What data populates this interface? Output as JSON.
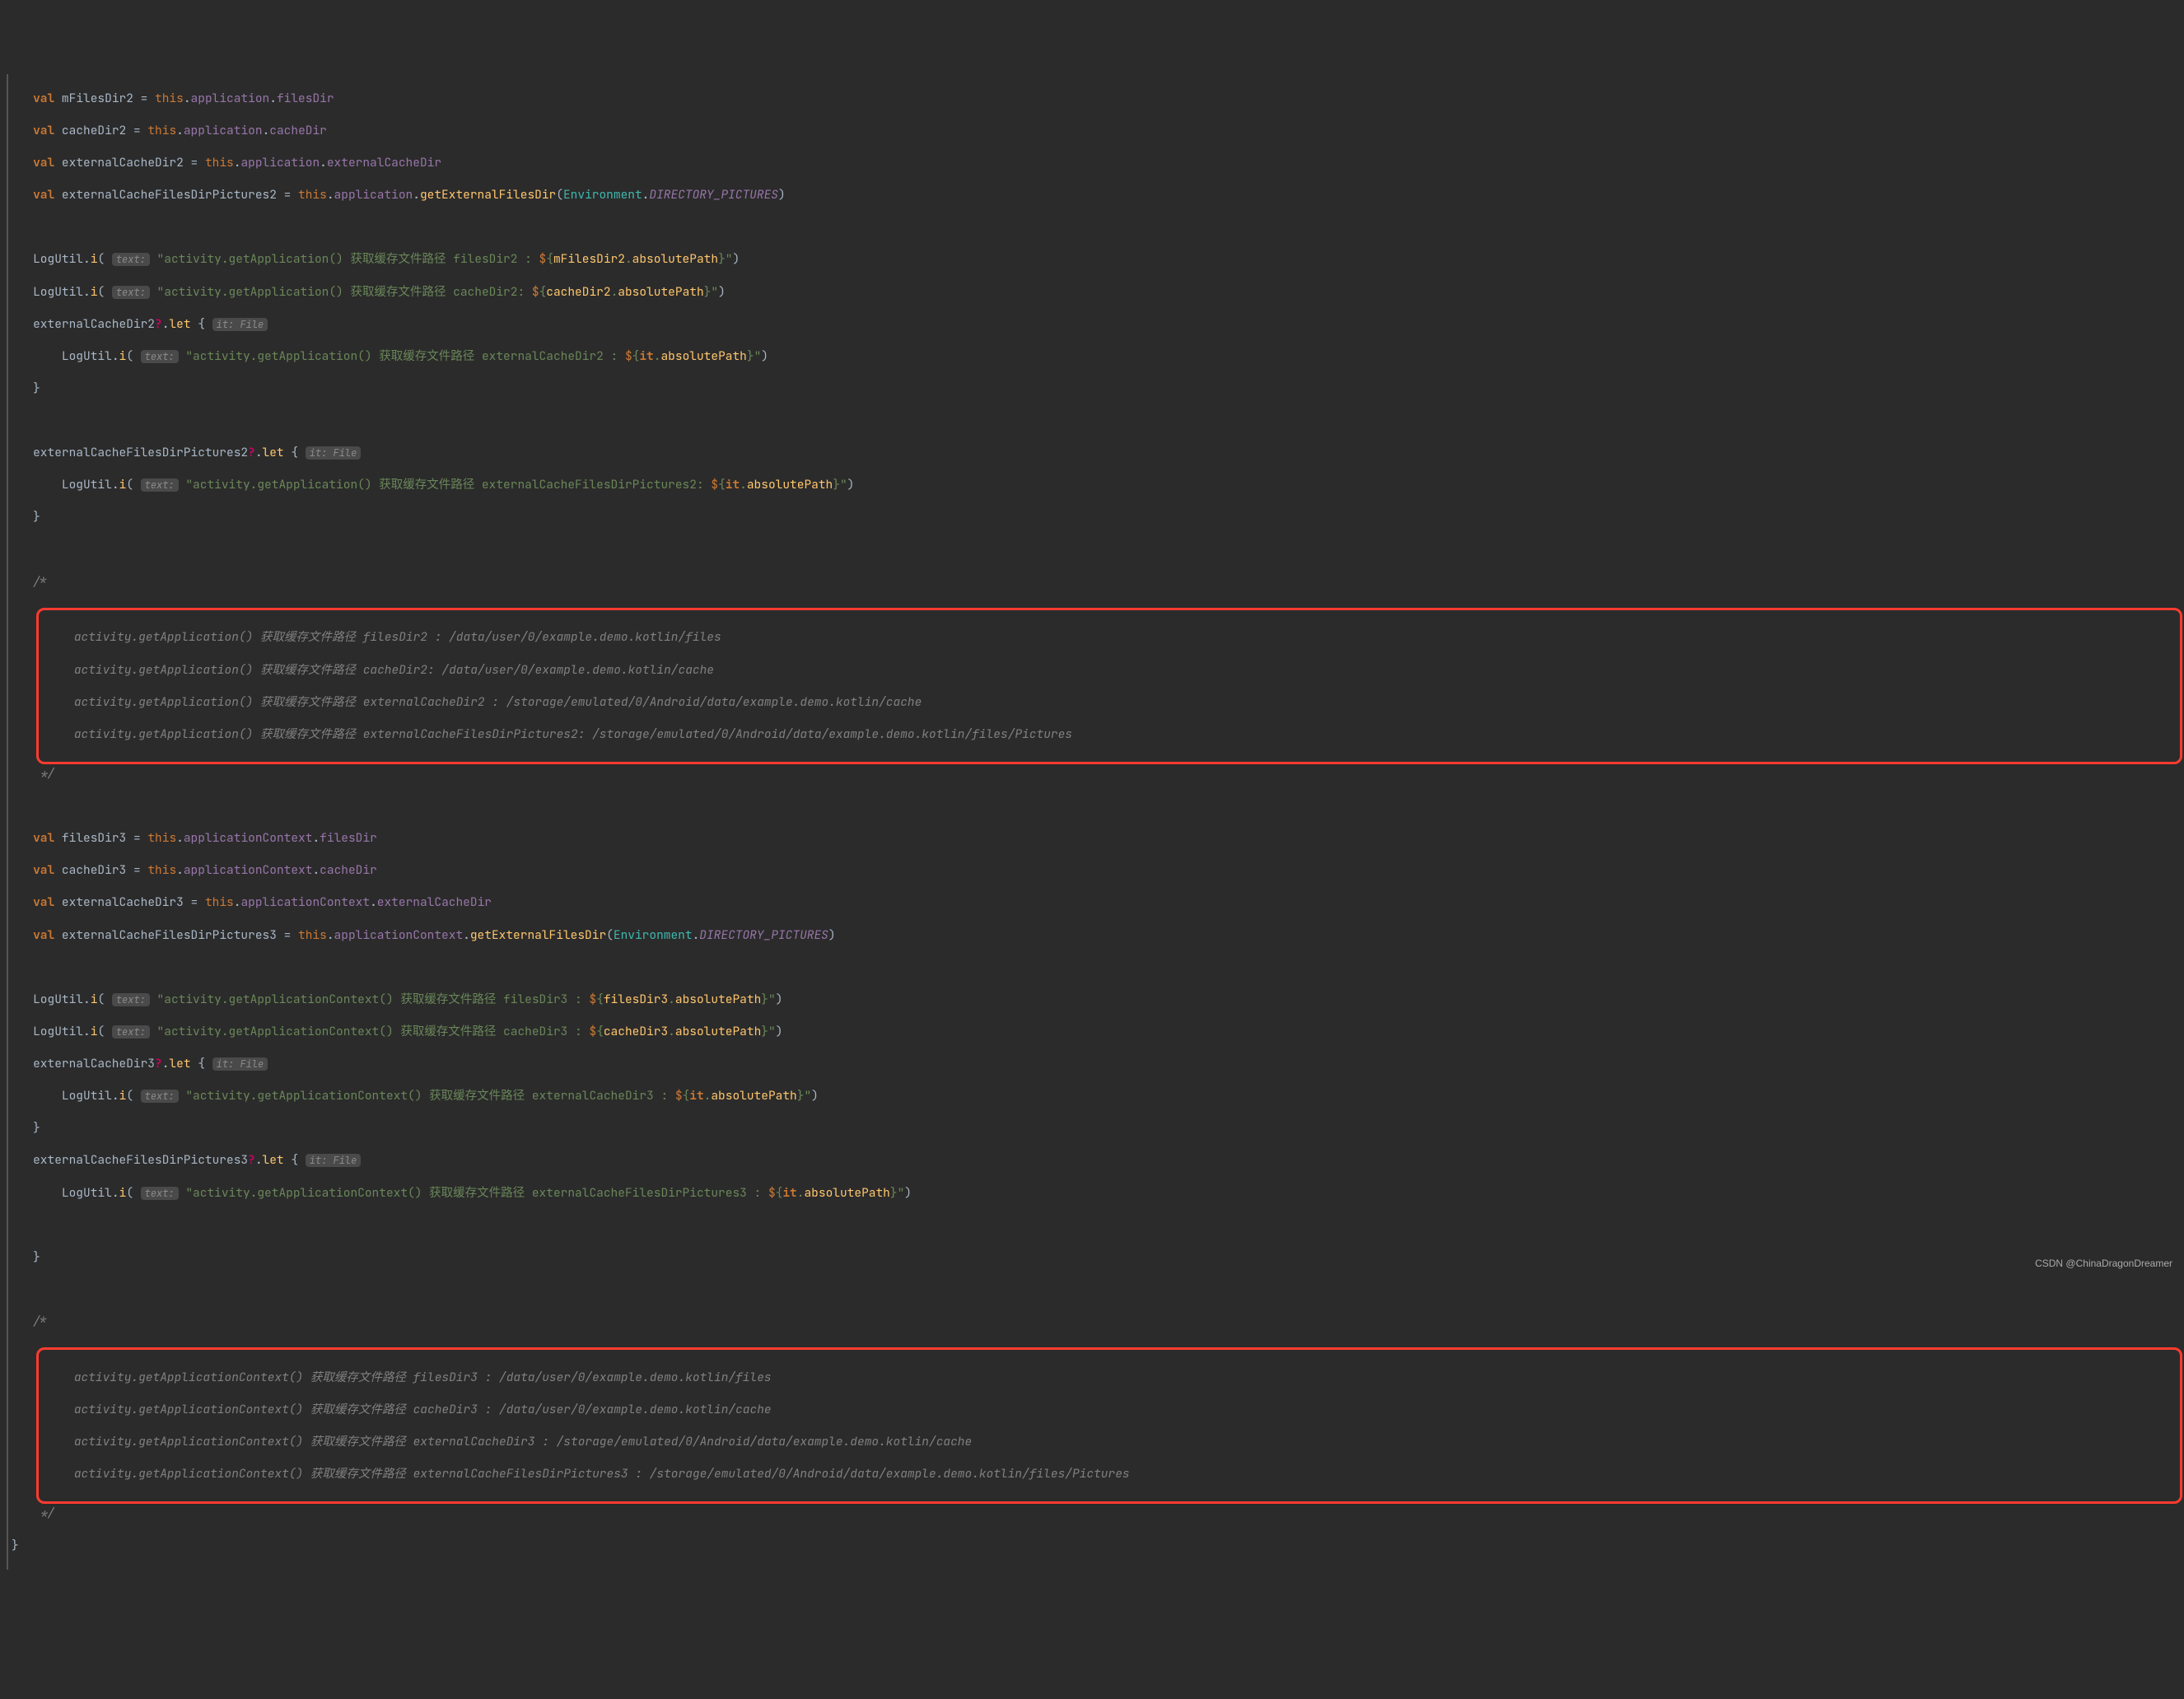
{
  "watermark": "CSDN @ChinaDragonDreamer",
  "hints": {
    "text_param": "text:",
    "it_file": "it: File"
  },
  "code": {
    "l1": {
      "v": "mFilesDir2",
      "p": "filesDir"
    },
    "l2": {
      "v": "cacheDir2",
      "p": "cacheDir"
    },
    "l3": {
      "v": "externalCacheDir2",
      "p": "externalCacheDir"
    },
    "l4": {
      "v": "externalCacheFilesDirPictures2",
      "f": "getExternalFilesDir",
      "env": "Environment",
      "c": "DIRECTORY_PICTURES"
    },
    "l5": {
      "cls": "LogUtil",
      "m": "i",
      "s1": "\"activity.getApplication() 获取缓存文件路径 filesDir2 : ",
      "v": "mFilesDir2",
      "p": "absolutePath",
      "s2": "\""
    },
    "l6": {
      "cls": "LogUtil",
      "m": "i",
      "s1": "\"activity.getApplication() 获取缓存文件路径 cacheDir2: ",
      "v": "cacheDir2",
      "p": "absolutePath",
      "s2": "\""
    },
    "l7": {
      "v": "externalCacheDir2",
      "let": "let"
    },
    "l8": {
      "cls": "LogUtil",
      "m": "i",
      "s1": "\"activity.getApplication() 获取缓存文件路径 externalCacheDir2 : ",
      "it": "it",
      "p": "absolutePath",
      "s2": "\""
    },
    "l9": {
      "v": "externalCacheFilesDirPictures2",
      "let": "let"
    },
    "l10": {
      "cls": "LogUtil",
      "m": "i",
      "s1": "\"activity.getApplication() 获取缓存文件路径 externalCacheFilesDirPictures2: ",
      "it": "it",
      "p": "absolutePath",
      "s2": "\""
    }
  },
  "comment1": {
    "l1": "activity.getApplication() 获取缓存文件路径 filesDir2 : /data/user/0/example.demo.kotlin/files",
    "l2": "activity.getApplication() 获取缓存文件路径 cacheDir2: /data/user/0/example.demo.kotlin/cache",
    "l3": "activity.getApplication() 获取缓存文件路径 externalCacheDir2 : /storage/emulated/0/Android/data/example.demo.kotlin/cache",
    "l4": "activity.getApplication() 获取缓存文件路径 externalCacheFilesDirPictures2: /storage/emulated/0/Android/data/example.demo.kotlin/files/Pictures"
  },
  "code2": {
    "l1": {
      "v": "filesDir3",
      "p": "filesDir"
    },
    "l2": {
      "v": "cacheDir3",
      "p": "cacheDir"
    },
    "l3": {
      "v": "externalCacheDir3",
      "p": "externalCacheDir"
    },
    "l4": {
      "v": "externalCacheFilesDirPictures3",
      "f": "getExternalFilesDir",
      "env": "Environment",
      "c": "DIRECTORY_PICTURES"
    },
    "l5": {
      "cls": "LogUtil",
      "m": "i",
      "s1": "\"activity.getApplicationContext() 获取缓存文件路径 filesDir3 : ",
      "v": "filesDir3",
      "p": "absolutePath",
      "s2": "\""
    },
    "l6": {
      "cls": "LogUtil",
      "m": "i",
      "s1": "\"activity.getApplicationContext() 获取缓存文件路径 cacheDir3 : ",
      "v": "cacheDir3",
      "p": "absolutePath",
      "s2": "\""
    },
    "l7": {
      "v": "externalCacheDir3",
      "let": "let"
    },
    "l8": {
      "cls": "LogUtil",
      "m": "i",
      "s1": "\"activity.getApplicationContext() 获取缓存文件路径 externalCacheDir3 : ",
      "it": "it",
      "p": "absolutePath",
      "s2": "\""
    },
    "l9": {
      "v": "externalCacheFilesDirPictures3",
      "let": "let"
    },
    "l10": {
      "cls": "LogUtil",
      "m": "i",
      "s1": "\"activity.getApplicationContext() 获取缓存文件路径 externalCacheFilesDirPictures3 : ",
      "it": "it",
      "p": "absolutePath",
      "s2": "\""
    }
  },
  "comment2": {
    "l1": "activity.getApplicationContext() 获取缓存文件路径 filesDir3 : /data/user/0/example.demo.kotlin/files",
    "l2": "activity.getApplicationContext() 获取缓存文件路径 cacheDir3 : /data/user/0/example.demo.kotlin/cache",
    "l3": "activity.getApplicationContext() 获取缓存文件路径 externalCacheDir3 : /storage/emulated/0/Android/data/example.demo.kotlin/cache",
    "l4": "activity.getApplicationContext() 获取缓存文件路径 externalCacheFilesDirPictures3 : /storage/emulated/0/Android/data/example.demo.kotlin/files/Pictures"
  },
  "kw": {
    "val": "val",
    "this": "this",
    "application": "application",
    "applicationContext": "applicationContext"
  }
}
